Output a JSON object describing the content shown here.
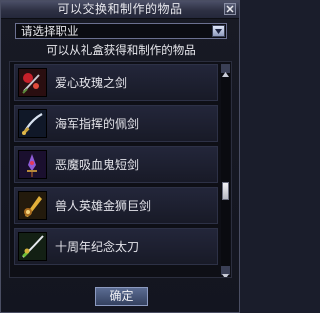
{
  "window": {
    "title": "可以交换和制作的物品"
  },
  "job_dropdown": {
    "selected": "请选择职业"
  },
  "subtitle": "可以从礼盒获得和制作的物品",
  "items": [
    {
      "label": "爱心玫瑰之剑",
      "icon": "rose-sword-icon"
    },
    {
      "label": "海军指挥的佩剑",
      "icon": "naval-saber-icon"
    },
    {
      "label": "恶魔吸血鬼短剑",
      "icon": "vampire-dagger-icon"
    },
    {
      "label": "兽人英雄金狮巨剑",
      "icon": "golden-lion-greatsword-icon"
    },
    {
      "label": "十周年纪念太刀",
      "icon": "anniversary-katana-icon"
    }
  ],
  "ok_button": {
    "label": "确定"
  },
  "colors": {
    "panel_bg": "#0e0f16",
    "title_bg": "#2e3144",
    "button_bg": "#46557a"
  }
}
